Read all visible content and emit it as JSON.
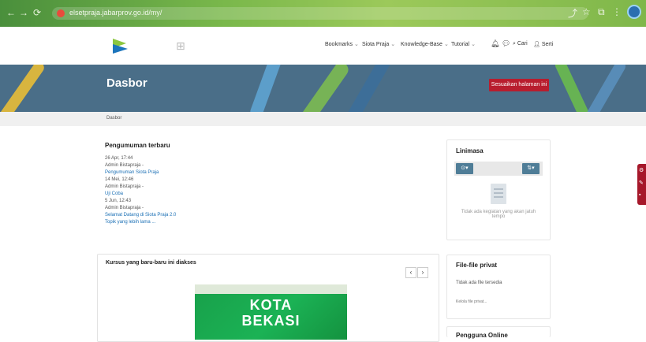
{
  "browser": {
    "url": "elsetpraja.jabarprov.go.id/my/",
    "nav_back": "←",
    "nav_forward": "→",
    "nav_reload": "⟳"
  },
  "navbar": {
    "menu": [
      "Bookmarks",
      "Siota Praja",
      "Knowledge-Base",
      "Tutorial"
    ],
    "search_label": "Cari",
    "user_label": "Serti"
  },
  "hero": {
    "title": "Dasbor",
    "customize_button": "Sesuaikan halaman ini"
  },
  "breadcrumb": {
    "current": "Dasbor"
  },
  "announcements": {
    "title": "Pengumuman terbaru",
    "items": [
      {
        "time": "26 Apr, 17:44",
        "author": "Admin Bistapraja -",
        "subject": "Pengumuman Siota Praja"
      },
      {
        "time": "14 Mei, 12:46",
        "author": "Admin Bistapraja -",
        "subject": "Uji Coba"
      },
      {
        "time": "5 Jun, 12:43",
        "author": "Admin Bistapraja -",
        "subject": "Selamat Datang di Siota Praja 2.0"
      }
    ],
    "older_link": "Topik yang lebih lama ..."
  },
  "recent_courses": {
    "title": "Kursus yang baru-baru ini diakses",
    "prev": "‹",
    "next": "›",
    "course_image_text": [
      "KOTA",
      "BEKASI"
    ]
  },
  "timeline": {
    "title": "Linimasa",
    "filter_button": "⊙▾",
    "sort_button": "⇅▾",
    "empty_text": "Tidak ada kegiatan yang akan jatuh tempo"
  },
  "private_files": {
    "title": "File-file privat",
    "empty_text": "Tidak ada file tersedia",
    "manage_link": "Kelola file privat..."
  },
  "online_users": {
    "title": "Pengguna Online"
  },
  "colors": {
    "primary": "#4f7d97",
    "accent_red": "#b81d2e",
    "hero_bg": "#4a6e88",
    "brand_green": "#1bb255"
  }
}
